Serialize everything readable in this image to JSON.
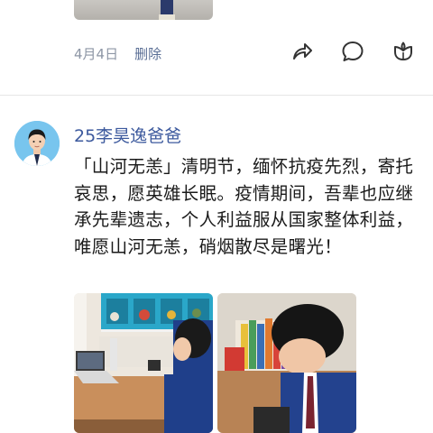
{
  "previous_post": {
    "date": "4月4日",
    "delete_label": "删除"
  },
  "action_icons": [
    "share-icon",
    "comment-icon",
    "like-icon"
  ],
  "post": {
    "username": "25李昊逸爸爸",
    "text": "「山河无恙」清明节，缅怀抗疫先烈，寄托哀思，愿英雄长眠。疫情期间，吾辈也应继承先辈遗志，个人利益服从国家整体利益，唯愿山河无恙，硝烟散尽是曙光！"
  },
  "colors": {
    "username": "#3d5a9e",
    "delete_link": "#5a6e95",
    "meta_text": "#8d96a5",
    "icon_stroke": "#333333",
    "avatar_bg": "#78c5ee"
  }
}
